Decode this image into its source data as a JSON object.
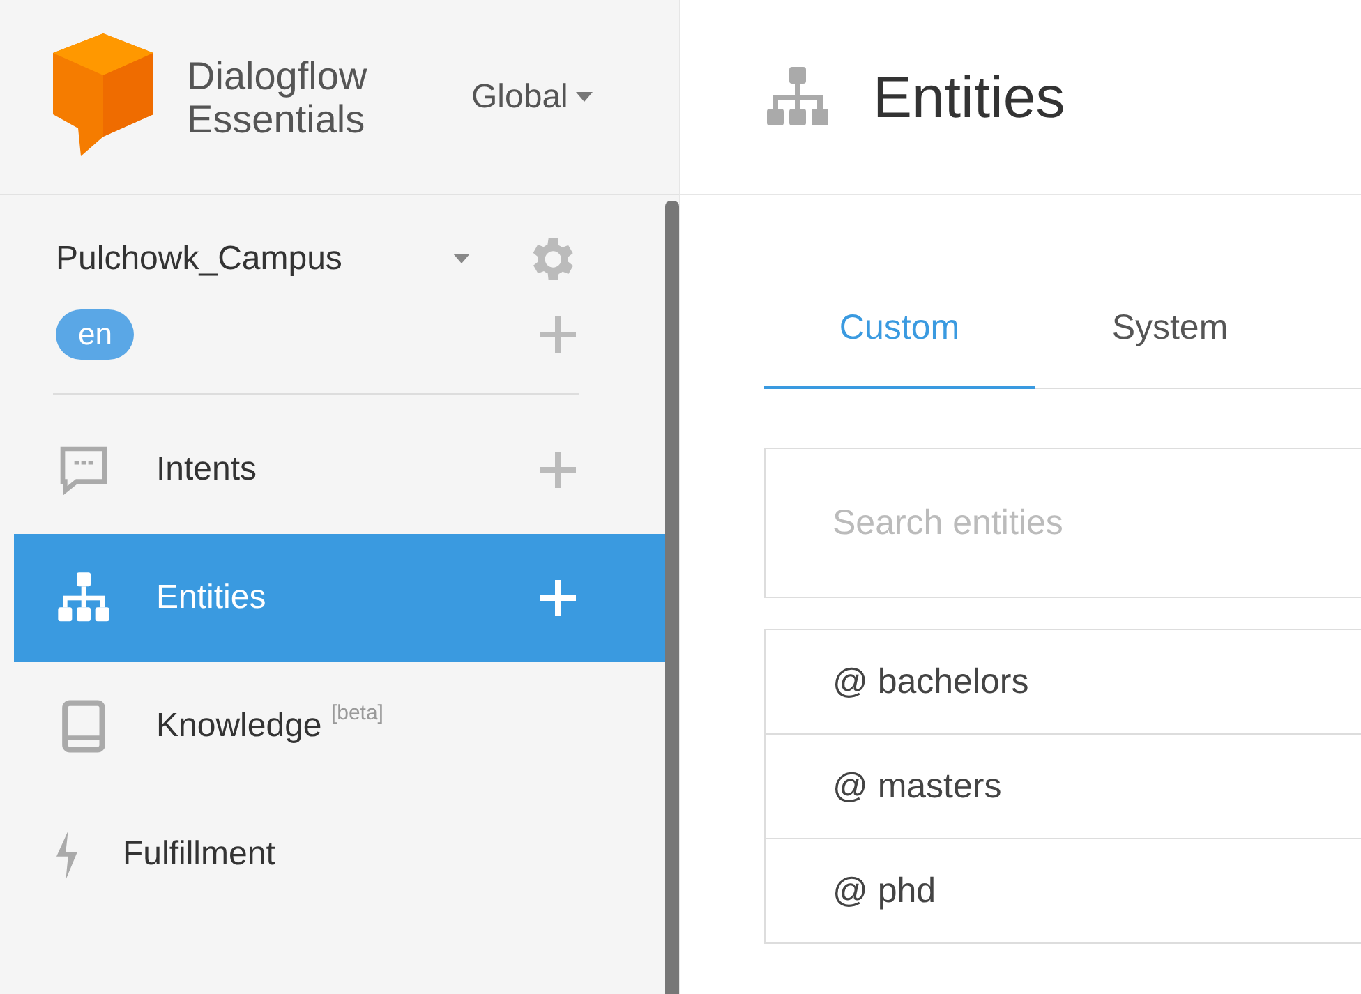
{
  "brand": {
    "line_1": "Dialogflow",
    "line_2": "Essentials"
  },
  "region": {
    "label": "Global"
  },
  "agent": {
    "name": "Pulchowk_Campus",
    "language": "en"
  },
  "nav": [
    {
      "label": "Intents",
      "selected": false,
      "has_add": true
    },
    {
      "label": "Entities",
      "selected": true,
      "has_add": true
    },
    {
      "label": "Knowledge $^{[beta]}$",
      "selected": false,
      "has_add": false
    },
    {
      "label": "Fulfillment",
      "selected": false,
      "has_add": false
    }
  ],
  "page": {
    "title": "Entities"
  },
  "tabs": [
    {
      "label": "Custom",
      "selected": true
    },
    {
      "label": "System",
      "selected": false
    }
  ],
  "search": {
    "placeholder": "Search entities"
  },
  "entities": [
    "@ bachelors",
    "@ masters",
    "@ phd"
  ]
}
